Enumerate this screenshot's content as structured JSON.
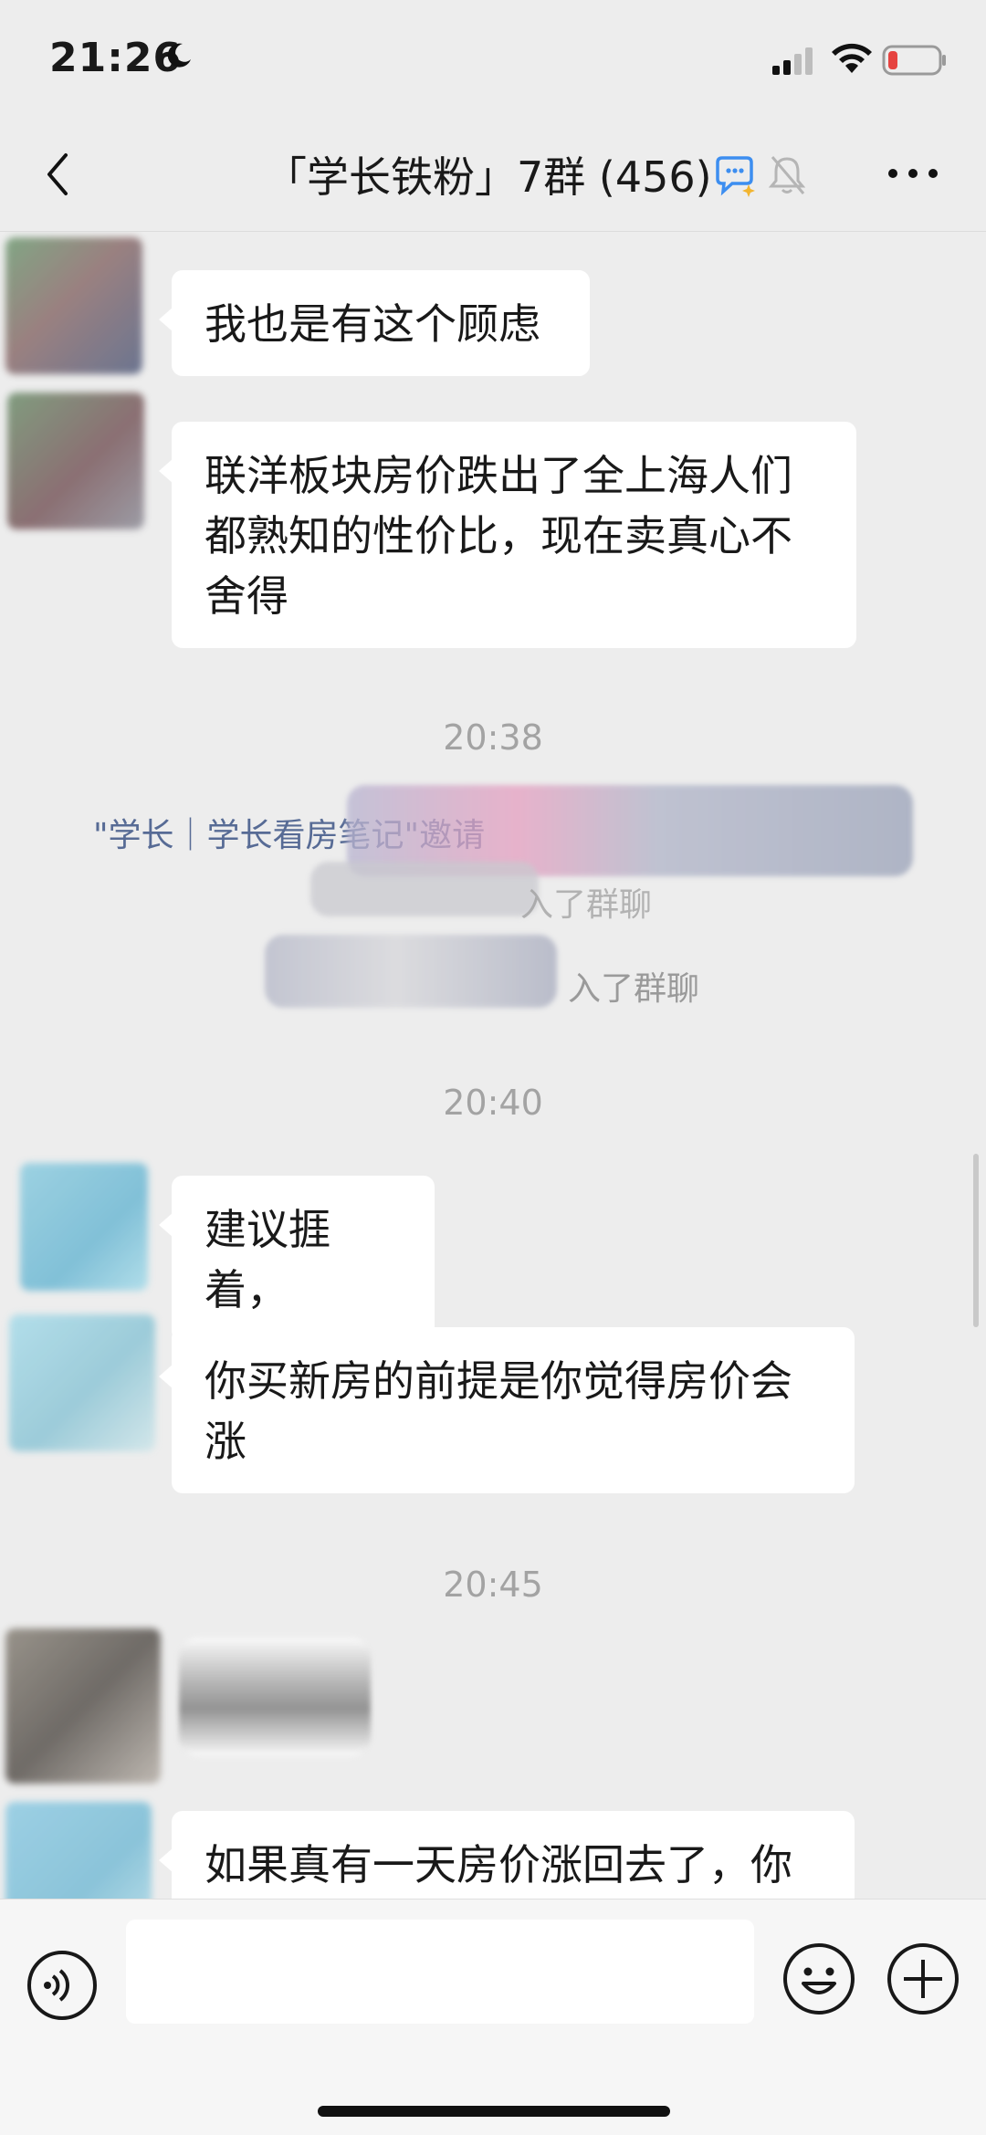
{
  "status_bar": {
    "time": "21:26",
    "icons": [
      "moon-icon",
      "signal-icon",
      "wifi-icon",
      "battery-low-icon"
    ],
    "battery_color": "#e64340"
  },
  "header": {
    "title": "「学长铁粉」7群 (456)",
    "icons": [
      "back-icon",
      "ai-chat-icon",
      "mute-bell-icon",
      "more-icon"
    ]
  },
  "messages": [
    {
      "type": "text",
      "text": "我也是有这个顾虑"
    },
    {
      "type": "text",
      "lines": [
        "联洋板块房价跌出了全上海人们",
        "都熟知的性价比，现在卖真心不",
        "舍得"
      ]
    },
    {
      "type": "time",
      "text": "20:38"
    },
    {
      "type": "system",
      "text": "\"学长｜学长看房笔记\"邀请",
      "tail_1": "入了群聊",
      "tail_2": "入了群聊"
    },
    {
      "type": "time",
      "text": "20:40"
    },
    {
      "type": "text",
      "text": "建议捱着，"
    },
    {
      "type": "text",
      "lines": [
        "你买新房的前提是你觉得房价会",
        "涨"
      ]
    },
    {
      "type": "time",
      "text": "20:45"
    },
    {
      "type": "text",
      "text": "如果真有一天房价涨回去了，你"
    }
  ],
  "input_bar": {
    "icons": [
      "voice-icon",
      "emoji-icon",
      "plus-icon"
    ]
  },
  "colors": {
    "background": "#ededed",
    "bubble": "#ffffff",
    "link": "#576b95",
    "timestamp": "#a3a3a3"
  }
}
